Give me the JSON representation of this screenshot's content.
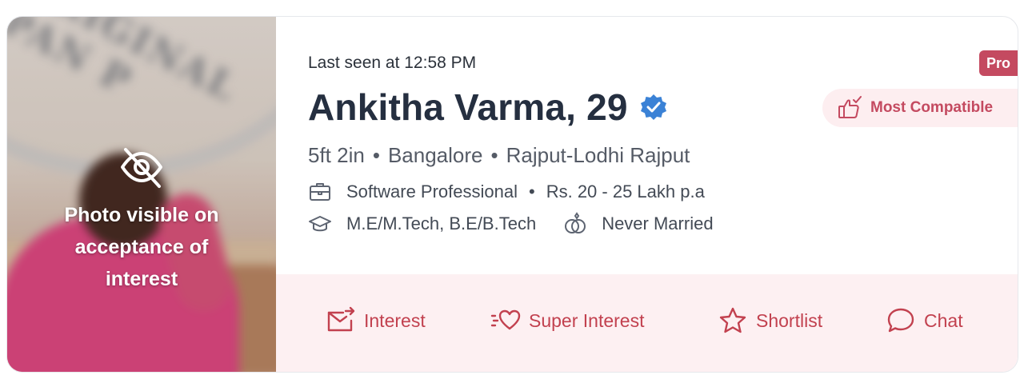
{
  "profile": {
    "last_seen": "Last seen at 12:58 PM",
    "name_age": "Ankitha Varma, 29",
    "height": "5ft 2in",
    "city": "Bangalore",
    "community": "Rajput-Lodhi Rajput",
    "profession": "Software Professional",
    "income": "Rs. 20 - 25 Lakh p.a",
    "education": "M.E/M.Tech, B.E/B.Tech",
    "marital_status": "Never Married",
    "separator": "•"
  },
  "photo": {
    "message": "Photo visible on acceptance of interest",
    "message_lines": [
      "Photo visible on",
      "acceptance of",
      "interest"
    ]
  },
  "badges": {
    "pro": "Pro",
    "compatibility": "Most Compatible"
  },
  "actions": {
    "interest": "Interest",
    "super_interest": "Super Interest",
    "shortlist": "Shortlist",
    "chat": "Chat"
  },
  "icons": {
    "hidden_photo": "eye-off-icon",
    "verified": "verified-badge-icon",
    "profession": "briefcase-icon",
    "education": "graduation-cap-icon",
    "marital": "rings-icon",
    "compatibility": "thumbs-up-check-icon",
    "interest": "mail-send-icon",
    "super_interest": "heart-dash-icon",
    "shortlist": "star-icon",
    "chat": "chat-bubble-icon"
  },
  "colors": {
    "accent": "#c44a60",
    "action_background": "#fdf0f2",
    "verified_blue": "#3b82d6",
    "name_text": "#252f40"
  }
}
